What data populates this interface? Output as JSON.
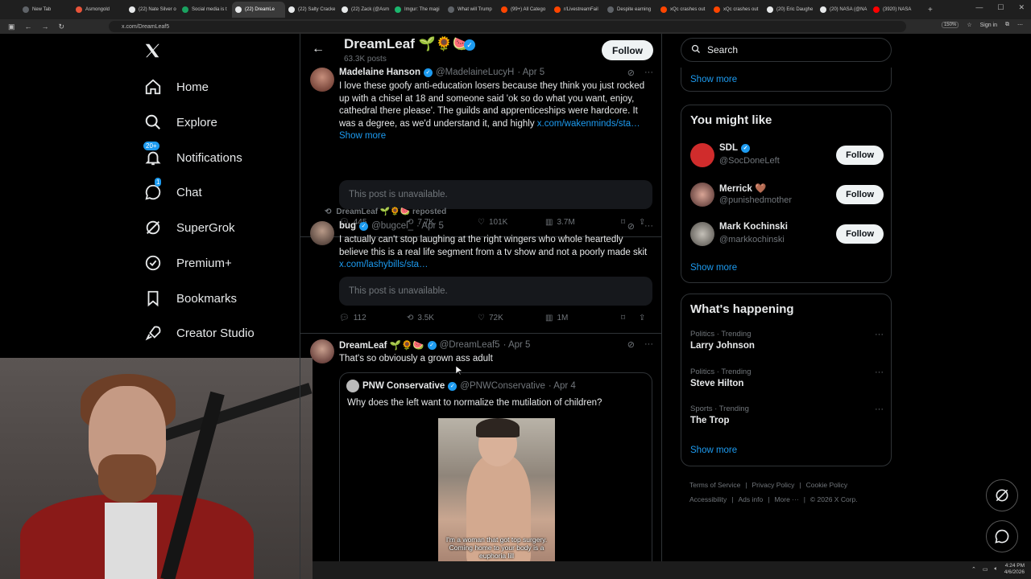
{
  "browser": {
    "tabs": [
      "New Tab",
      "Asmongold",
      "(22) Nate Silver o",
      "Social media is t",
      "(22) DreamLe",
      "(22) Salty Cracke",
      "(22) Zack (@Asm",
      "Imgur: The magi",
      "What will Trump",
      "(99+) All Catego",
      "r/LivestreamFail",
      "Despite earning",
      "xQc crashes out",
      "xQc crashes out",
      "(20) Eric Daughe",
      "(20) NASA (@NA",
      "(3920) NASA"
    ],
    "tab_colors": [
      "#5f6368",
      "#e8543a",
      "#e7e9ea",
      "#1aa260",
      "#e7e9ea",
      "#e7e9ea",
      "#e7e9ea",
      "#1bb76e",
      "#5f6368",
      "#ff4500",
      "#ff4500",
      "#5f6368",
      "#ff4500",
      "#ff4500",
      "#e7e9ea",
      "#e7e9ea",
      "#ff0000"
    ],
    "url": "x.com/DreamLeaf5",
    "zoom": "150%",
    "sign_in": "Sign in"
  },
  "nav": {
    "items": [
      {
        "label": "Home",
        "icon": "home-icon"
      },
      {
        "label": "Explore",
        "icon": "search-icon"
      },
      {
        "label": "Notifications",
        "icon": "bell-icon",
        "badge": "20+"
      },
      {
        "label": "Chat",
        "icon": "chat-icon",
        "badge": "1"
      },
      {
        "label": "SuperGrok",
        "icon": "grok-icon"
      },
      {
        "label": "Premium+",
        "icon": "premium-icon"
      },
      {
        "label": "Bookmarks",
        "icon": "bookmark-icon"
      },
      {
        "label": "Creator Studio",
        "icon": "rocket-icon"
      }
    ]
  },
  "profile": {
    "name": "DreamLeaf 🌱🌻🍉",
    "posts_count": "63.3K posts",
    "follow_label": "Follow"
  },
  "posts": [
    {
      "name": "Madelaine Hanson",
      "handle": "@MadelaineLucyH",
      "date": "· Apr 5",
      "text": "I love these goofy anti-education losers because they think you just rocked up with a chisel at 18 and someone said 'ok so do what you want, enjoy, cathedral there please'. The guilds and apprenticeships were hardcore. It was a degree, as we'd understand it, and highly ",
      "link": "x.com/wakenminds/sta…",
      "show_more": "Show more",
      "unavailable": "This post is unavailable.",
      "replies": "445",
      "reposts": "7.7K",
      "likes": "101K",
      "views": "3.7M"
    },
    {
      "reposted_by": "DreamLeaf 🌱🌻🍉 reposted",
      "name": "bug",
      "handle": "@bugcel_",
      "date": "· Apr 5",
      "text": "I actually can't stop laughing at the right wingers who whole heartedly believe this is a real life segment from a tv show and not a poorly made skit ",
      "link": "x.com/lashybills/sta…",
      "unavailable": "This post is unavailable.",
      "replies": "112",
      "reposts": "3.5K",
      "likes": "72K",
      "views": "1M"
    },
    {
      "name": "DreamLeaf 🌱🌻🍉",
      "handle": "@DreamLeaf5",
      "date": "· Apr 5",
      "text": "That's so obviously a grown ass adult",
      "quote": {
        "name": "PNW Conservative",
        "handle": "@PNWConservative",
        "date": "· Apr 4",
        "text": "Why does the left want to normalize the mutilation of children?",
        "caption": "I'm a woman that got top surgery. Coming home to your body is a euphoria lill"
      }
    }
  ],
  "right": {
    "search_placeholder": "Search",
    "show_more_top": "Show more",
    "suggest_title": "You might like",
    "suggestions": [
      {
        "name": "SDL",
        "handle": "@SocDoneLeft",
        "follow": "Follow"
      },
      {
        "name": "Merrick 🤎",
        "handle": "@punishedmother",
        "follow": "Follow"
      },
      {
        "name": "Mark Kochinski",
        "handle": "@markkochinski",
        "follow": "Follow"
      }
    ],
    "show_more_suggest": "Show more",
    "happening_title": "What's happening",
    "trends": [
      {
        "category": "Politics · Trending",
        "name": "Larry Johnson"
      },
      {
        "category": "Politics · Trending",
        "name": "Steve Hilton"
      },
      {
        "category": "Sports · Trending",
        "name": "The Trop"
      }
    ],
    "show_more_trends": "Show more",
    "footer": [
      "Terms of Service",
      "Privacy Policy",
      "Cookie Policy",
      "Accessibility",
      "Ads info",
      "More ···",
      "© 2026 X Corp."
    ]
  },
  "taskbar": {
    "time": "4:24 PM",
    "date": "4/6/2026"
  }
}
